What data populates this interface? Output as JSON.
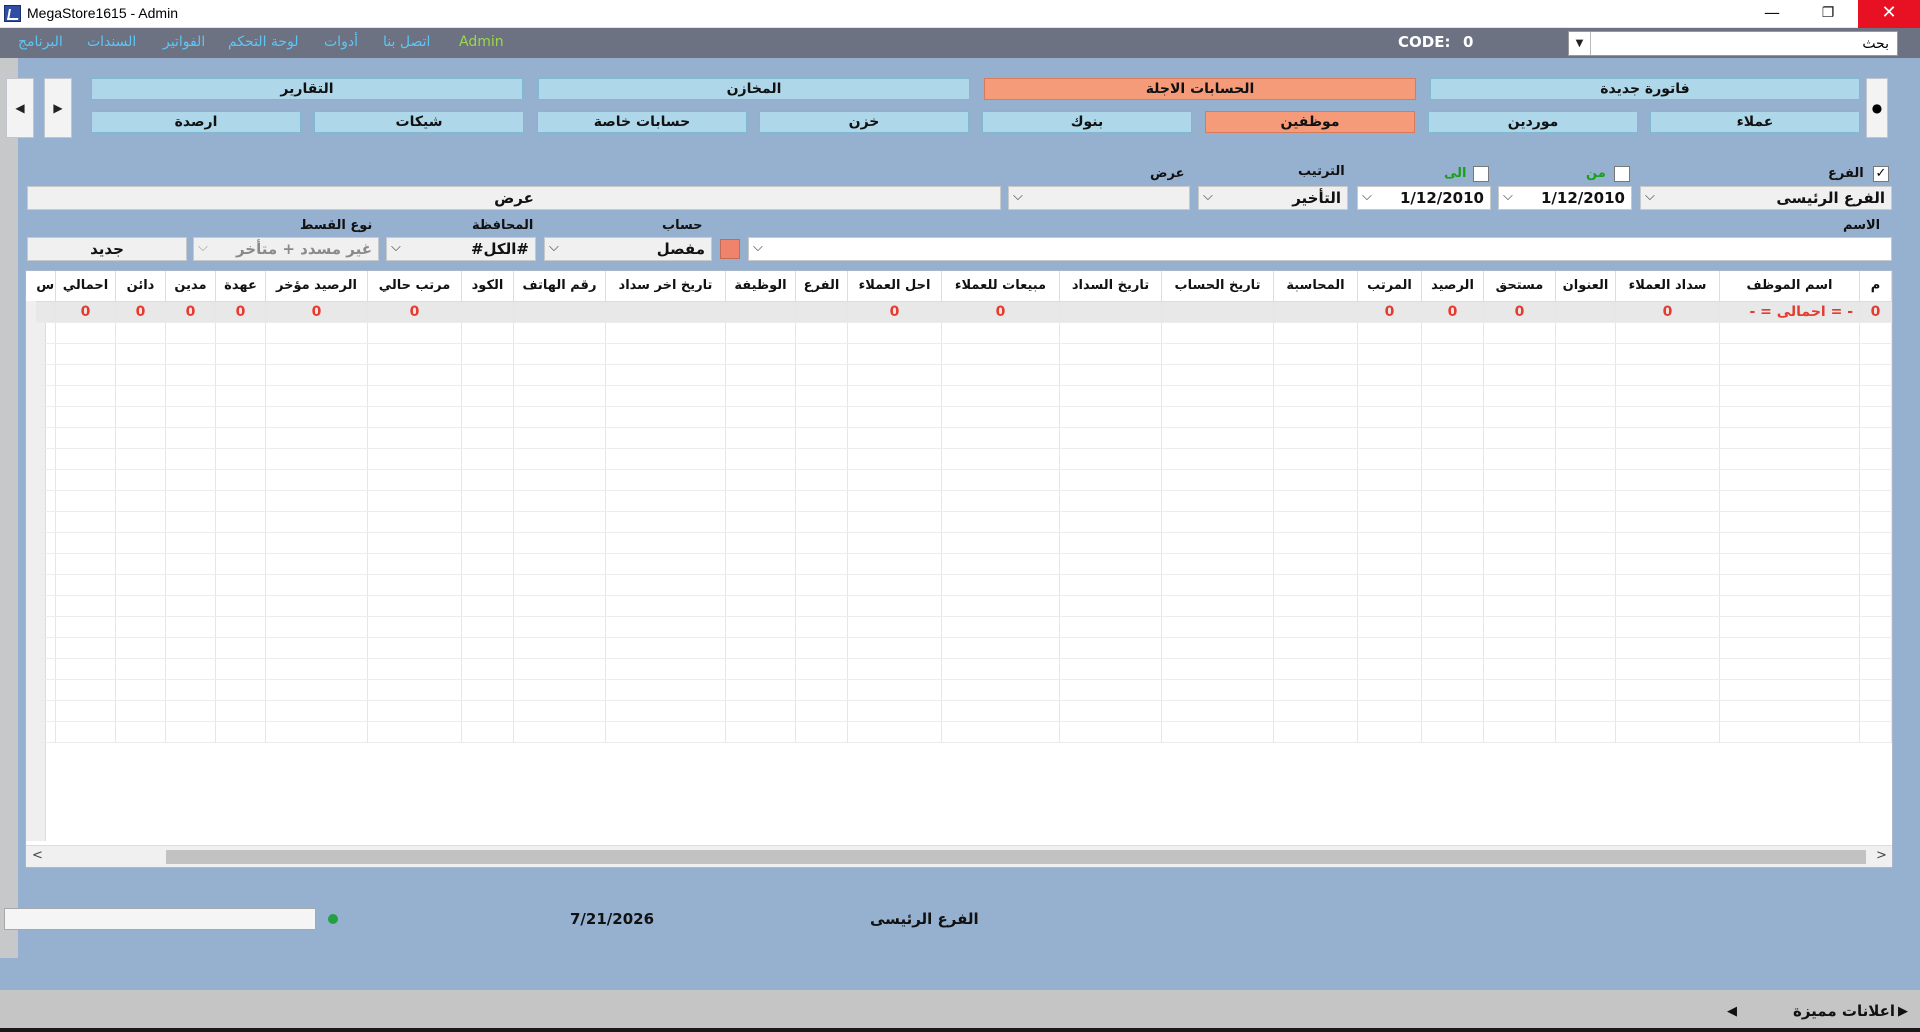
{
  "window": {
    "title": "MegaStore1615 - Admin",
    "minimize": "—",
    "maximize": "❐",
    "close": "✕"
  },
  "menu": {
    "items": [
      "البرنامج",
      "السندات",
      "الفواتير",
      "لوحة التحكم",
      "أدوات",
      "اتصل بنا"
    ],
    "user": "Admin",
    "code_label": "CODE:",
    "code_value": "0",
    "search_value": "بحث"
  },
  "nav": {
    "prev": "◀",
    "next": "▶",
    "more": "●"
  },
  "tabs": {
    "row1": [
      "فاتورة جديدة",
      "الحسابات الاجلة",
      "المخازن",
      "التقارير"
    ],
    "row2": [
      "عملاء",
      "موردين",
      "موظفين",
      "بنوك",
      "خزن",
      "حسابات خاصة",
      "شيكات",
      "ارصدة"
    ],
    "active_row1": "الحسابات الاجلة",
    "active_row2": "موظفين"
  },
  "filters": {
    "branch_label": "الفرع",
    "branch_checked": "✓",
    "branch_value": "الفرع الرئيسى",
    "from_label": "من",
    "to_label": "الى",
    "date_from": "1/12/2010",
    "date_to": "1/12/2010",
    "sort_label": "الترتيب",
    "sort_value": "التأخير",
    "view_label": "عرض",
    "view_value": "",
    "view_button": "عرض",
    "name_label": "الاسم",
    "name_value": "",
    "account_label": "حساب",
    "account_value": "مفصل",
    "governorate_label": "المحافظة",
    "governorate_value": "#الكل#",
    "installment_label": "نوع القسط",
    "installment_value": "غير مسدد + متأخر",
    "new_button": "جديد",
    "accent_color": "#f0836b"
  },
  "grid": {
    "columns": [
      "م",
      "اسم الموظف",
      "سداد العملاء",
      "العنوان",
      "مستحق",
      "الرصيد",
      "المرتب",
      "المحاسبة",
      "تاريخ الحساب",
      "تاريخ السداد",
      "مبيعات للعملاء",
      "احل العملاء",
      "الفرع",
      "الوظيفة",
      "تاريخ اخر سداد",
      "رقم الهاتف",
      "الكود",
      "مرتب حالي",
      "الرصيد مؤخر",
      "عهدة",
      "مدين",
      "دائن",
      "احمالي",
      "س"
    ],
    "total_row": [
      "0",
      "- = احمالى = -",
      "0",
      "",
      "0",
      "0",
      "0",
      "",
      "",
      "",
      "0",
      "0",
      "",
      "",
      "",
      "",
      "",
      "0",
      "0",
      "0",
      "0",
      "0",
      "0",
      ""
    ]
  },
  "status": {
    "date": "7/21/2026",
    "branch": "الفرع الرئيسى",
    "indicator_color": "#22a042"
  },
  "ads": {
    "label": "اعلانات مميزة",
    "left_arrow": "◀",
    "right_arrow": "▶"
  }
}
